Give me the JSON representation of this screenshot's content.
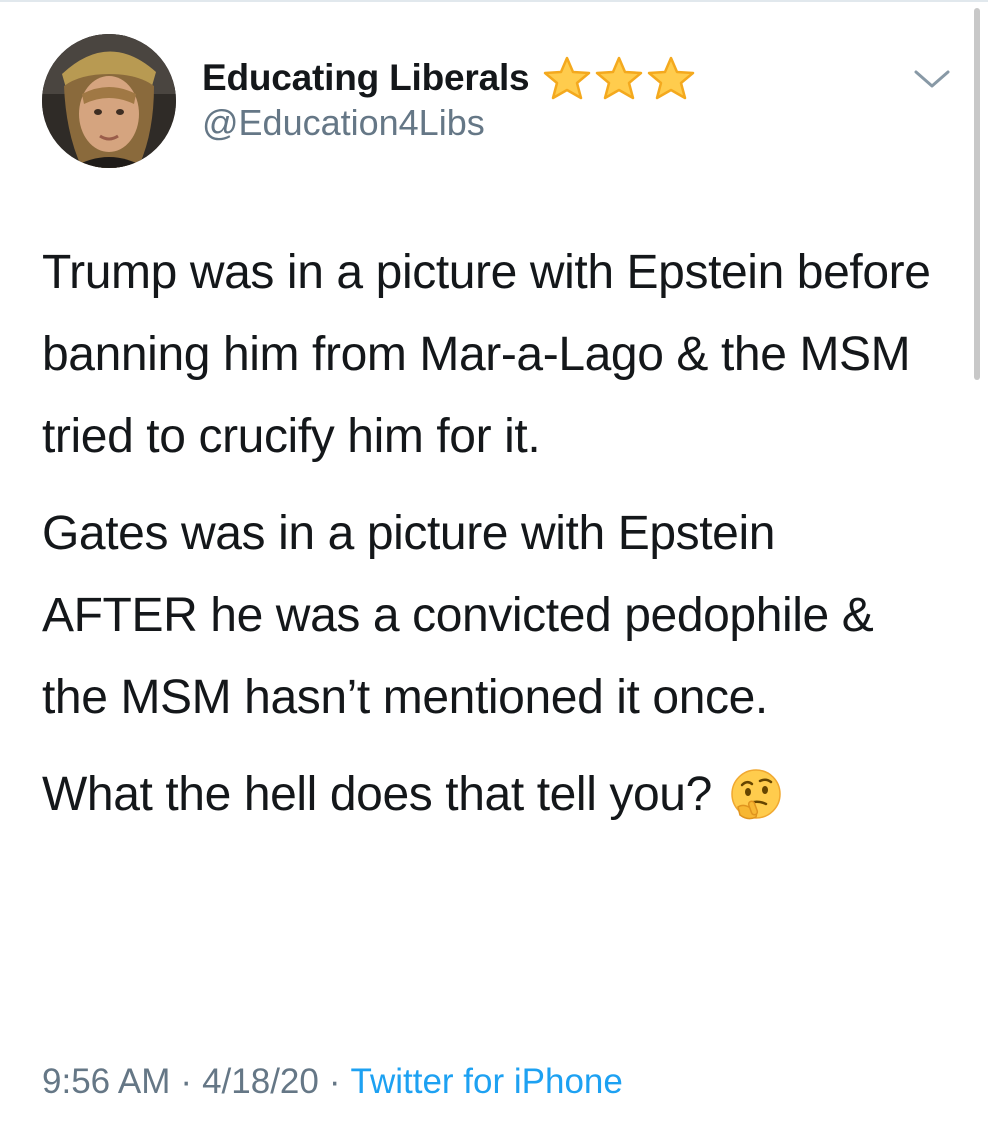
{
  "author": {
    "display_name": "Educating Liberals",
    "handle": "@Education4Libs",
    "badge_icons": [
      "star-icon",
      "star-icon",
      "star-icon"
    ]
  },
  "tweet": {
    "paragraphs": [
      "Trump was in a picture with Epstein before banning him from Mar-a-Lago & the MSM tried to crucify him for it.",
      "Gates was in a picture with Epstein AFTER he was a convicted pedophile & the MSM hasn’t mentioned it once."
    ],
    "last_line": "What the hell does that tell you?",
    "emoji": "thinking-face-icon"
  },
  "meta": {
    "time": "9:56 AM",
    "separator": "·",
    "date": "4/18/20",
    "source": "Twitter for iPhone"
  },
  "colors": {
    "text": "#14171a",
    "secondary": "#657786",
    "link": "#1da1f2",
    "star_fill": "#ffcc4d",
    "star_stroke": "#f4a91e"
  }
}
